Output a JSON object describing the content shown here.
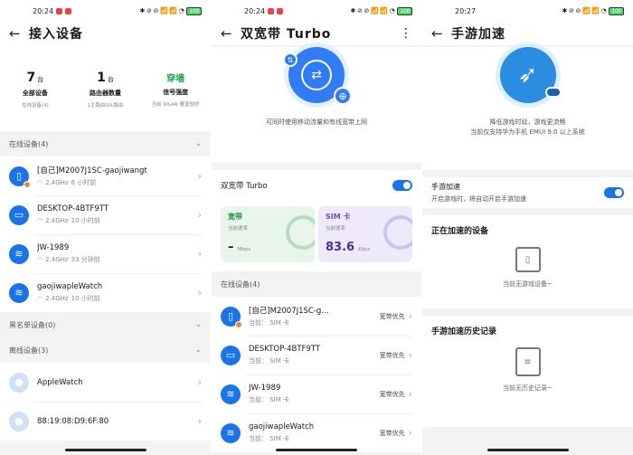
{
  "panel1": {
    "status": {
      "time": "20:24",
      "icons": "✱ ⊘ ⊘ 📶 📶 ◔",
      "battery": "100"
    },
    "title": "接入设备",
    "stats": [
      {
        "value": "7",
        "unit": "台",
        "label": "全部设备",
        "sub": "在线设备(4)"
      },
      {
        "value": "1",
        "unit": "台",
        "label": "路由器数量",
        "sub": "1主路由0从路由"
      },
      {
        "value": "穿墙",
        "unit": "",
        "label": "信号强度",
        "sub": "当前 WLAN 覆盖较好"
      }
    ],
    "online_header": "在线设备(4)",
    "online": [
      {
        "name": "[自己]M2007J1SC-gaojiwangt",
        "band": "2.4GHz",
        "time": "6 小时前",
        "icon": "phone-icon"
      },
      {
        "name": "DESKTOP-4BTF9TT",
        "band": "2.4GHz",
        "time": "10 小时前",
        "icon": "monitor-icon"
      },
      {
        "name": "JW-1989",
        "band": "2.4GHz",
        "time": "33 分钟前",
        "icon": "wifi-icon"
      },
      {
        "name": "gaojiwapleWatch",
        "band": "2.4GHz",
        "time": "10 小时前",
        "icon": "wifi-icon"
      }
    ],
    "blacklist_header": "黑名单设备(0)",
    "offline_header": "离线设备(3)",
    "offline": [
      {
        "name": "AppleWatch",
        "icon": "apple-icon"
      },
      {
        "name": "88:19:08:D9:6F:80",
        "icon": "apple-icon"
      }
    ]
  },
  "panel2": {
    "status": {
      "time": "20:24",
      "icons": "✱ ⊘ ⊘ 📶 📶 ◔",
      "battery": "100"
    },
    "title": "双宽带 Turbo",
    "caption": "可同时使用移动流量和有线宽带上网",
    "toggle_label": "双宽带 Turbo",
    "cards": [
      {
        "title": "宽带",
        "sub": "当前速率",
        "value": "–",
        "unit": "Mbps"
      },
      {
        "title": "SIM 卡",
        "sub": "当前速率",
        "value": "83.6",
        "unit": "Kbps"
      }
    ],
    "online_header": "在线设备(4)",
    "devices": [
      {
        "name": "[自己]M2007J1SC-g…",
        "sub": "当前： SIM 卡",
        "priority": "宽带优先",
        "icon": "phone-icon"
      },
      {
        "name": "DESKTOP-4BTF9TT",
        "sub": "当前： SIM 卡",
        "priority": "宽带优先",
        "icon": "monitor-icon"
      },
      {
        "name": "JW-1989",
        "sub": "当前： SIM 卡",
        "priority": "宽带优先",
        "icon": "wifi-icon"
      },
      {
        "name": "gaojiwapleWatch",
        "sub": "当前： SIM 卡",
        "priority": "宽带优先",
        "icon": "wifi-icon"
      }
    ]
  },
  "panel3": {
    "status": {
      "time": "20:27",
      "icons": "✱ ⊘ ⊘ 📶 📶 ◔",
      "battery": "100"
    },
    "title": "手游加速",
    "caption1": "降低游戏时延，游戏更流畅",
    "caption2": "当前仅支持华为手机 EMUI 9.0 以上系统",
    "toggle_title": "手游加速",
    "toggle_sub": "开启游戏时，将自动开启手游加速",
    "accelerating_title": "正在加速的设备",
    "accelerating_empty": "当前无游戏设备~",
    "history_title": "手游加速历史记录",
    "history_empty": "当前无历史记录~"
  }
}
